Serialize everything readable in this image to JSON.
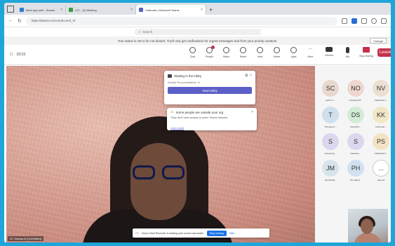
{
  "browser": {
    "tabs": [
      {
        "label": "timer app web - Search",
        "color": "#2b7cd3",
        "active": false
      },
      {
        "label": "CIT... (2) Meeting",
        "color": "#3a9a4b",
        "active": false
      },
      {
        "label": "Calendar | Microsoft Teams",
        "color": "#5b5fc7",
        "active": true
      }
    ],
    "new_tab": "+",
    "url": "https://teams.microsoft.com/_#/",
    "search_placeholder": "Search"
  },
  "banner": {
    "text": "Your status is set to do not disturb. You'll only get notifications for urgent messages and from your priority contacts.",
    "button": "Change"
  },
  "toolbar": {
    "timer": "23:19",
    "tools": [
      {
        "label": "Chat",
        "icon": "chat-icon"
      },
      {
        "label": "People",
        "icon": "people-icon"
      },
      {
        "label": "Raise",
        "icon": "raise-hand-icon"
      },
      {
        "label": "React",
        "icon": "react-icon"
      },
      {
        "label": "View",
        "icon": "view-icon"
      },
      {
        "label": "Notes",
        "icon": "notes-icon"
      },
      {
        "label": "Apps",
        "icon": "apps-icon"
      },
      {
        "label": "More",
        "icon": "more-icon"
      }
    ],
    "camera": "Camera",
    "mic": "Mic",
    "share": "Stop sharing",
    "leave": "Leave"
  },
  "lobby_popup": {
    "title": "Waiting in the lobby",
    "who": "Sachin Pa (Unverified) +4",
    "button": "View lobby"
  },
  "notice_popup": {
    "title": "Some people are outside your org",
    "body": "They don't have access to some Teams features.",
    "link": "Learn more"
  },
  "video": {
    "name_tag": "Dr. Garima B (Unverified)"
  },
  "sharebar": {
    "message": "Zoom Greet Recorder is sharing your screen and audio.",
    "stop": "Stop sharing",
    "hide": "Hide"
  },
  "attendees": [
    {
      "initials": "SC",
      "name": "sachin C...",
      "color": "#e8d8cf"
    },
    {
      "initials": "NO",
      "name": "Chandrani B...",
      "color": "#efd7d1"
    },
    {
      "initials": "NV",
      "name": "Nakshatra V...",
      "color": "#ece0d3"
    },
    {
      "initials": "T",
      "name": "Thirupati N...",
      "color": "#cfe0ec"
    },
    {
      "initials": "DS",
      "name": "DHANUS...",
      "color": "#d3ecd5"
    },
    {
      "initials": "KK",
      "name": "KHILASH...",
      "color": "#f1e6c6"
    },
    {
      "initials": "S",
      "name": "Sumandra...",
      "color": "#dcd6ef"
    },
    {
      "initials": "S",
      "name": "Sakshiwo...",
      "color": "#dcd6ef"
    },
    {
      "initials": "PS",
      "name": "PRASHANT...",
      "color": "#f3e3c4"
    },
    {
      "initials": "JM",
      "name": "JAYASURI...",
      "color": "#d8e4ec"
    },
    {
      "initials": "PH",
      "name": "PCI HELE...",
      "color": "#d2e1f1"
    },
    {
      "initials": "...",
      "name": "View all",
      "color": "#ffffff"
    }
  ]
}
